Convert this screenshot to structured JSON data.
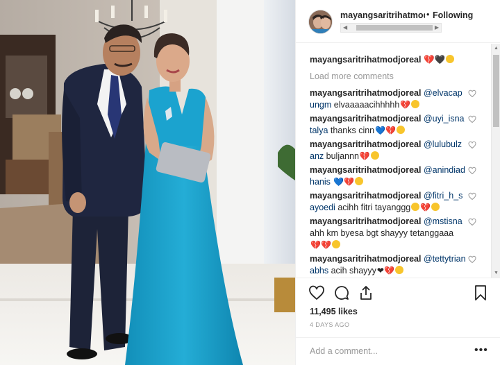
{
  "post": {
    "username": "mayangsaritrihatmodjoreal",
    "follow_dot": "•",
    "follow_label": "Following",
    "caption_hearts": "💔🖤",
    "load_more": "Load more comments",
    "likes": "11,495 likes",
    "time_ago": "4 DAYS AGO",
    "add_comment_placeholder": "Add a comment...",
    "more_options": "•••"
  },
  "comments": [
    {
      "username": "mayangsaritrihatmodjoreal",
      "mention": "@elvacapungm",
      "text": "elvaaaaacihhhhh",
      "emoji": "💔"
    },
    {
      "username": "mayangsaritrihatmodjoreal",
      "mention": "@uyi_isnatalya",
      "text": "thanks cinn",
      "emoji": "💙💔"
    },
    {
      "username": "mayangsaritrihatmodjoreal",
      "mention": "@lulubulzanz",
      "text": "buljannn",
      "emoji": "💔"
    },
    {
      "username": "mayangsaritrihatmodjoreal",
      "mention": "@anindiadhanis",
      "text": "",
      "emoji": "💙💔"
    },
    {
      "username": "mayangsaritrihatmodjoreal",
      "mention": "@fitri_h_sayoedi",
      "text": "acihh fitri tayanggg",
      "emoji": "💔"
    },
    {
      "username": "mayangsaritrihatmodjoreal",
      "mention": "@mstisna",
      "text": "ahh km byesa bgt shayyy tetanggaaa",
      "emoji": "💔💔"
    },
    {
      "username": "mayangsaritrihatmodjoreal",
      "mention": "@tettytrianabhs",
      "text": "acih shayyy",
      "emoji": "❤💔"
    }
  ],
  "icons": {
    "like": "heart-outline-icon",
    "comment": "speech-bubble-icon",
    "share": "share-icon",
    "save": "bookmark-icon"
  },
  "colors": {
    "mention": "#003569",
    "muted": "#999999",
    "dress": "#1ba3cf"
  }
}
